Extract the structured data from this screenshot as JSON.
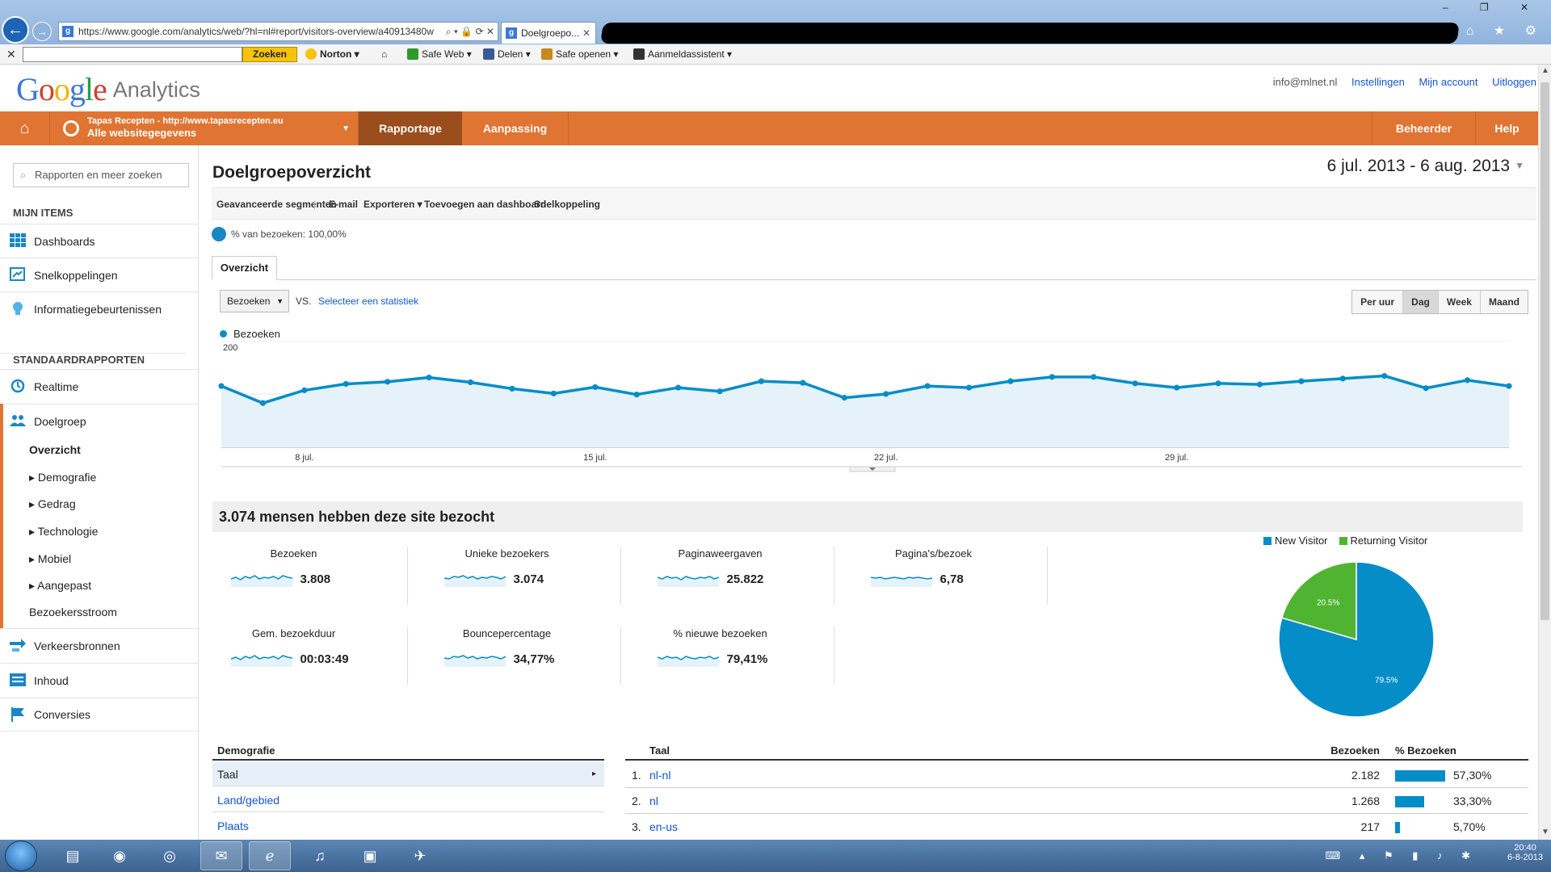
{
  "browser": {
    "address_url": "https://www.google.com/analytics/web/?hl=nl#report/visitors-overview/a40913480w",
    "address_tools": "⌕ ▾ 🔒 ⟳ ✕",
    "tab_title": "Doelgroepo...",
    "window_controls": "– ❐ ✕",
    "right_tools": "⌂ ★ ⚙"
  },
  "toolbar": {
    "search_button": "Zoeken",
    "norton": "Norton ▾",
    "safe_web": "Safe Web ▾",
    "delen": "Delen ▾",
    "safe_openen": "Safe openen ▾",
    "aanmeldassistent": "Aanmeldassistent ▾"
  },
  "header": {
    "logo_google": [
      "G",
      "o",
      "o",
      "g",
      "l",
      "e"
    ],
    "logo_analytics": "Analytics",
    "email": "info@mlnet.nl",
    "links": [
      "Instellingen",
      "Mijn account",
      "Uitloggen"
    ]
  },
  "orange_bar": {
    "site_line1": "Tapas Recepten - http://www.tapasrecepten.eu",
    "site_line2": "Alle websitegegevens",
    "tabs": [
      "Rapportage",
      "Aanpassing"
    ],
    "right_tabs": [
      "Beheerder",
      "Help"
    ]
  },
  "sidebar": {
    "search_placeholder": "Rapporten en meer zoeken",
    "section_my_items": "MIJN ITEMS",
    "my_items": [
      "Dashboards",
      "Snelkoppelingen",
      "Informatiegebeurtenissen"
    ],
    "section_standard": "STANDAARDRAPPORTEN",
    "realtime": "Realtime",
    "doelgroep": "Doelgroep",
    "doelgroep_sub": [
      "Overzicht",
      "Demografie",
      "Gedrag",
      "Technologie",
      "Mobiel",
      "Aangepast",
      "Bezoekersstroom"
    ],
    "other_reports": [
      "Verkeersbronnen",
      "Inhoud",
      "Conversies"
    ]
  },
  "main": {
    "title": "Doelgroepoverzicht",
    "date_range": "6 jul. 2013 - 6 aug. 2013",
    "actions": [
      "Geavanceerde segmenten",
      "E-mail",
      "Exporteren ▾",
      "Toevoegen aan dashboard",
      "Snelkoppeling"
    ],
    "segment_text": "% van bezoeken: 100,00%",
    "overview_tab": "Overzicht",
    "metric_select": "Bezoeken",
    "vs": "VS.",
    "select_stat": "Selecteer een statistiek",
    "granularity": [
      "Per uur",
      "Dag",
      "Week",
      "Maand"
    ],
    "active_granularity": "Dag",
    "summary_title": "3.074 mensen hebben deze site bezocht",
    "metrics": [
      {
        "label": "Bezoeken",
        "value": "3.808"
      },
      {
        "label": "Unieke bezoekers",
        "value": "3.074"
      },
      {
        "label": "Paginaweergaven",
        "value": "25.822"
      },
      {
        "label": "Pagina's/bezoek",
        "value": "6,78"
      },
      {
        "label": "Gem. bezoekduur",
        "value": "00:03:49"
      },
      {
        "label": "Bouncepercentage",
        "value": "34,77%"
      },
      {
        "label": "% nieuwe bezoeken",
        "value": "79,41%"
      }
    ],
    "demografie_header": "Demografie",
    "demografie_rows": [
      "Taal",
      "Land/gebied",
      "Plaats"
    ],
    "lang_header": {
      "taal": "Taal",
      "bezoeken": "Bezoeken",
      "pct": "% Bezoeken"
    },
    "lang_rows": [
      {
        "n": "1.",
        "taal": "nl-nl",
        "bezoeken": "2.182",
        "pct": "57,30%",
        "frac": 0.573
      },
      {
        "n": "2.",
        "taal": "nl",
        "bezoeken": "1.268",
        "pct": "33,30%",
        "frac": 0.333
      },
      {
        "n": "3.",
        "taal": "en-us",
        "bezoeken": "217",
        "pct": "5,70%",
        "frac": 0.057
      }
    ]
  },
  "chart_data": [
    {
      "type": "area",
      "series": [
        {
          "name": "Bezoeken",
          "values": [
            115,
            83,
            107,
            119,
            123,
            131,
            122,
            110,
            101,
            113,
            99,
            112,
            105,
            124,
            121,
            93,
            100,
            115,
            112,
            124,
            132,
            132,
            120,
            112,
            120,
            118,
            124,
            129,
            134,
            111,
            126,
            115
          ]
        }
      ],
      "x_tick_labels": [
        "8 jul.",
        "15 jul.",
        "22 jul.",
        "29 jul."
      ],
      "x_tick_index": [
        2,
        9,
        16,
        23
      ],
      "ylim": [
        0,
        200
      ],
      "y_ticks": [
        100,
        200
      ],
      "grid": true,
      "color": "#058dc7"
    },
    {
      "type": "pie",
      "slices": [
        {
          "name": "New Visitor",
          "value": 79.5,
          "label": "79.5%",
          "color": "#058dc7"
        },
        {
          "name": "Returning Visitor",
          "value": 20.5,
          "label": "20.5%",
          "color": "#50b432"
        }
      ],
      "legend": "top"
    }
  ]
}
